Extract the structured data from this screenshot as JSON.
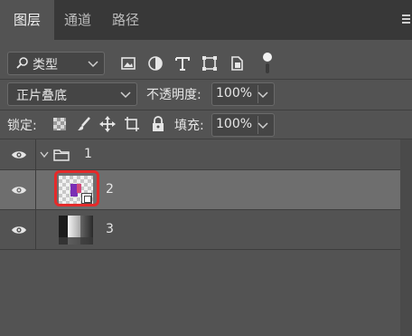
{
  "tabs": [
    {
      "label": "图层",
      "active": true
    },
    {
      "label": "通道",
      "active": false
    },
    {
      "label": "路径",
      "active": false
    }
  ],
  "filter": {
    "kind_label": "类型",
    "icons": [
      "image-filter-icon",
      "adjustment-filter-icon",
      "type-filter-icon",
      "shape-filter-icon",
      "smart-object-filter-icon",
      "filter-toggle-icon"
    ]
  },
  "blend": {
    "mode": "正片叠底",
    "opacity_label": "不透明度:",
    "opacity_value": "100%"
  },
  "lock": {
    "label": "锁定:",
    "icons": [
      "lock-transparent-pixels-icon",
      "lock-image-pixels-icon",
      "lock-position-icon",
      "lock-artboard-icon",
      "lock-all-icon"
    ],
    "fill_label": "填充:",
    "fill_value": "100%"
  },
  "layers": [
    {
      "name": "1",
      "type": "group",
      "visible": true,
      "expanded": true
    },
    {
      "name": "2",
      "type": "smart-object",
      "visible": true,
      "selected": true
    },
    {
      "name": "3",
      "type": "pixel",
      "visible": true
    }
  ],
  "colors": {
    "panel_bg": "#535353",
    "tabbar_bg": "#383838",
    "selected_row": "#6e6e6e",
    "highlight": "#e52a2a"
  }
}
